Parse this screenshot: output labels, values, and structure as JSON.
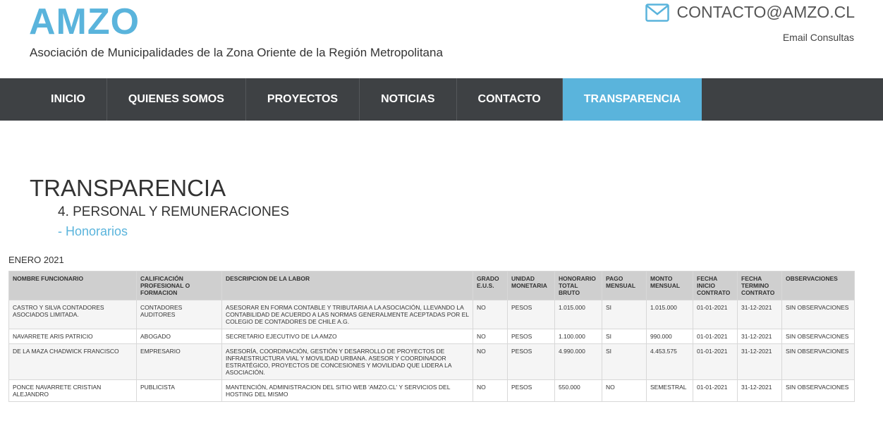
{
  "brand": {
    "logo": "AMZO",
    "subtitle": "Asociación de Municipalidades de la Zona Oriente de la Región Metropolitana",
    "contact_email": "CONTACTO@AMZO.CL",
    "contact_label": "Email Consultas",
    "accent_color": "#5ab4dc"
  },
  "nav": {
    "items": [
      {
        "label": "INICIO"
      },
      {
        "label": "QUIENES SOMOS"
      },
      {
        "label": "PROYECTOS"
      },
      {
        "label": "NOTICIAS"
      },
      {
        "label": "CONTACTO"
      },
      {
        "label": "TRANSPARENCIA",
        "active": true
      }
    ]
  },
  "page": {
    "title": "TRANSPARENCIA",
    "section": "4. PERSONAL Y REMUNERACIONES",
    "subsection": "- Honorarios",
    "period": "ENERO 2021"
  },
  "table": {
    "headers": [
      "NOMBRE FUNCIONARIO",
      "CALIFICACIÓN PROFESIONAL O FORMACION",
      "DESCRIPCION DE LA LABOR",
      "GRADO E.U.S.",
      "UNIDAD MONETARIA",
      "HONORARIO TOTAL BRUTO",
      "PAGO MENSUAL",
      "MONTO MENSUAL",
      "FECHA INICIO CONTRATO",
      "FECHA TERMINO CONTRATO",
      "OBSERVACIONES"
    ],
    "rows": [
      [
        "CASTRO  Y SILVA  CONTADORES ASOCIADOS  LIMITADA.",
        "CONTADORES AUDITORES",
        "ASESORAR EN FORMA CONTABLE Y TRIBUTARIA A LA ASOCIACIÓN,  LLEVANDO LA CONTABILIDAD DE ACUERDO A LAS NORMAS GENERALMENTE ACEPTADAS POR EL COLEGIO DE CONTADORES DE CHILE A.G.",
        "NO",
        "PESOS",
        "1.015.000",
        "SI",
        "1.015.000",
        "01-01-2021",
        "31-12-2021",
        "SIN OBSERVACIONES"
      ],
      [
        "NAVARRETE ARIS PATRICIO",
        "ABOGADO",
        "SECRETARIO EJECUTIVO DE LA AMZO",
        "NO",
        "PESOS",
        "1.100.000",
        "SI",
        "990.000",
        "01-01-2021",
        "31-12-2021",
        "SIN OBSERVACIONES"
      ],
      [
        " DE LA MAZA CHADWICK FRANCISCO",
        "EMPRESARIO",
        "ASESORÍA, COORDINACIÓN, GESTIÓN Y DESARROLLO DE PROYECTOS DE INFRAESTRUCTURA VIAL Y MOVILIDAD URBANA. ASESOR Y COORDINADOR ESTRATÉGICO, PROYECTOS DE CONCESIONES Y MOVILIDAD QUE LIDERA LA ASOCIACIÓN.",
        "NO",
        "PESOS",
        "4.990.000",
        "SI",
        "4.453.575",
        "01-01-2021",
        "31-12-2021",
        "SIN OBSERVACIONES"
      ],
      [
        "PONCE NAVARRETE CRISTIAN ALEJANDRO",
        "PUBLICISTA",
        "MANTENCIÓN, ADMINISTRACION DEL SITIO WEB 'AMZO.CL' Y SERVICIOS DEL HOSTING DEL MISMO",
        "NO",
        "PESOS",
        "550.000",
        "NO",
        "SEMESTRAL",
        "01-01-2021",
        "31-12-2021",
        "SIN OBSERVACIONES"
      ]
    ]
  }
}
